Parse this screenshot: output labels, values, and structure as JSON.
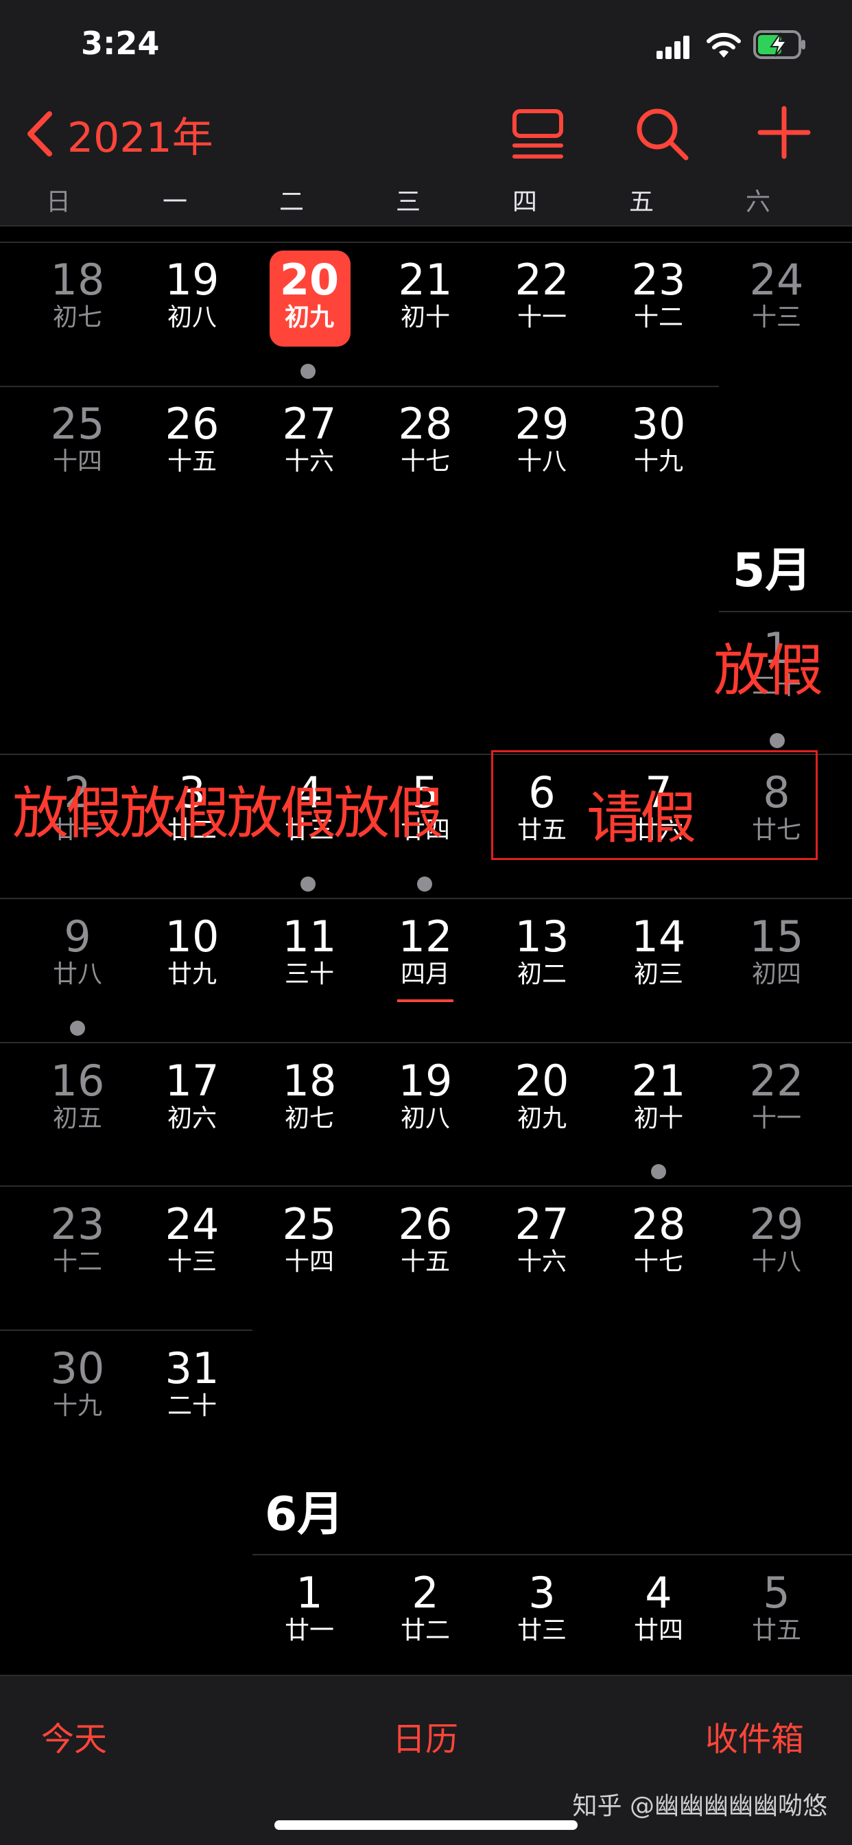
{
  "status": {
    "time": "3:24"
  },
  "nav": {
    "year": "2021年"
  },
  "weekdays": [
    "日",
    "一",
    "二",
    "三",
    "四",
    "五",
    "六"
  ],
  "weeks": {
    "w1": [
      {
        "d": "18",
        "l": "初七"
      },
      {
        "d": "19",
        "l": "初八"
      },
      {
        "d": "20",
        "l": "初九"
      },
      {
        "d": "21",
        "l": "初十"
      },
      {
        "d": "22",
        "l": "十一"
      },
      {
        "d": "23",
        "l": "十二"
      },
      {
        "d": "24",
        "l": "十三"
      }
    ],
    "w2": [
      {
        "d": "25",
        "l": "十四"
      },
      {
        "d": "26",
        "l": "十五"
      },
      {
        "d": "27",
        "l": "十六"
      },
      {
        "d": "28",
        "l": "十七"
      },
      {
        "d": "29",
        "l": "十八"
      },
      {
        "d": "30",
        "l": "十九"
      }
    ],
    "may_w1": [
      {
        "d": "1",
        "l": "二十"
      }
    ],
    "may_w2": [
      {
        "d": "2",
        "l": "廿一"
      },
      {
        "d": "3",
        "l": "廿二"
      },
      {
        "d": "4",
        "l": "廿三"
      },
      {
        "d": "5",
        "l": "廿四"
      },
      {
        "d": "6",
        "l": "廿五"
      },
      {
        "d": "7",
        "l": "廿六"
      },
      {
        "d": "8",
        "l": "廿七"
      }
    ],
    "may_w3": [
      {
        "d": "9",
        "l": "廿八"
      },
      {
        "d": "10",
        "l": "廿九"
      },
      {
        "d": "11",
        "l": "三十"
      },
      {
        "d": "12",
        "l": "四月"
      },
      {
        "d": "13",
        "l": "初二"
      },
      {
        "d": "14",
        "l": "初三"
      },
      {
        "d": "15",
        "l": "初四"
      }
    ],
    "may_w4": [
      {
        "d": "16",
        "l": "初五"
      },
      {
        "d": "17",
        "l": "初六"
      },
      {
        "d": "18",
        "l": "初七"
      },
      {
        "d": "19",
        "l": "初八"
      },
      {
        "d": "20",
        "l": "初九"
      },
      {
        "d": "21",
        "l": "初十"
      },
      {
        "d": "22",
        "l": "十一"
      }
    ],
    "may_w5": [
      {
        "d": "23",
        "l": "十二"
      },
      {
        "d": "24",
        "l": "十三"
      },
      {
        "d": "25",
        "l": "十四"
      },
      {
        "d": "26",
        "l": "十五"
      },
      {
        "d": "27",
        "l": "十六"
      },
      {
        "d": "28",
        "l": "十七"
      },
      {
        "d": "29",
        "l": "十八"
      }
    ],
    "may_w6": [
      {
        "d": "30",
        "l": "十九"
      },
      {
        "d": "31",
        "l": "二十"
      }
    ],
    "jun_w1": [
      {
        "d": "1",
        "l": "廿一"
      },
      {
        "d": "2",
        "l": "廿二"
      },
      {
        "d": "3",
        "l": "廿三"
      },
      {
        "d": "4",
        "l": "廿四"
      },
      {
        "d": "5",
        "l": "廿五"
      }
    ]
  },
  "months": {
    "may": "5月",
    "june": "6月"
  },
  "annotations": {
    "holiday_top": "放假",
    "holiday_row": "放假放假放假放假",
    "leave": "请假"
  },
  "tabbar": {
    "today": "今天",
    "calendars": "日历",
    "inbox": "收件箱"
  },
  "watermark": "知乎 @幽幽幽幽幽呦悠",
  "colors": {
    "accent": "#ff453a",
    "annotation": "#ff3b30",
    "event_dot": "#8e8e93"
  }
}
